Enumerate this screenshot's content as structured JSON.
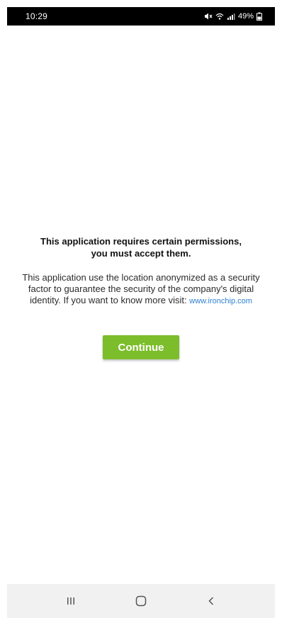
{
  "status_bar": {
    "time": "10:29",
    "battery_percent": "49%",
    "icons": [
      "mute-icon",
      "wifi-icon",
      "signal-icon",
      "battery-icon"
    ]
  },
  "permission": {
    "title": "This application requires certain permissions, you must accept them.",
    "description": "This application use the location anonymized as a security factor to guarantee the security of the company's digital identity. If you want to know more visit:",
    "link_text": "www.ironchip.com"
  },
  "continue_button": {
    "label": "Continue",
    "color": "#7cbd2b"
  },
  "nav_bar": {
    "buttons": [
      "recents-icon",
      "home-icon",
      "back-icon"
    ]
  },
  "colors": {
    "status_bar_bg": "#000000",
    "link": "#2f80d1",
    "nav_bar_bg": "#f1f1f1"
  }
}
